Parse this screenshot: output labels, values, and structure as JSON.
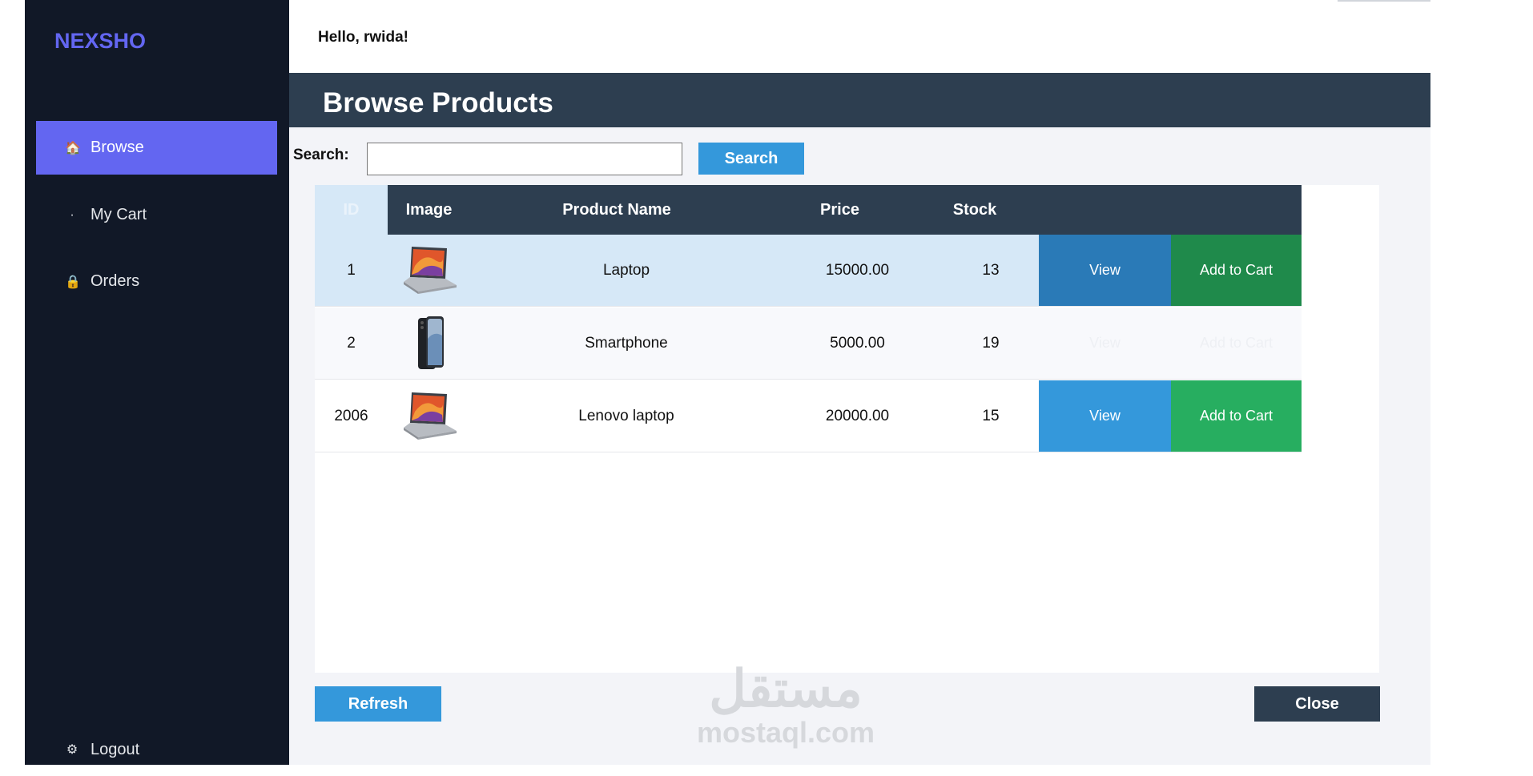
{
  "sidebar": {
    "brand": "NEXSHO",
    "items": [
      {
        "label": "Browse",
        "icon": "home-icon",
        "glyph": "🏠"
      },
      {
        "label": "My Cart",
        "icon": "bullet-icon",
        "glyph": "·"
      },
      {
        "label": "Orders",
        "icon": "lock-icon",
        "glyph": "🔒"
      }
    ],
    "logout": {
      "label": "Logout",
      "icon": "gear-icon",
      "glyph": "⚙"
    }
  },
  "header": {
    "greeting": "Hello, rwida!"
  },
  "page": {
    "title": "Browse Products"
  },
  "search": {
    "label": "Search:",
    "value": "",
    "button": "Search"
  },
  "table": {
    "columns": [
      "ID",
      "Image",
      "Product Name",
      "Price",
      "Stock"
    ],
    "rows": [
      {
        "id": "1",
        "image": "laptop-image",
        "name": "Laptop",
        "price": "15000.00",
        "stock": "13",
        "view": "View",
        "add": "Add to Cart"
      },
      {
        "id": "2",
        "image": "smartphone-image",
        "name": "Smartphone",
        "price": "5000.00",
        "stock": "19",
        "view": "View",
        "add": "Add to Cart"
      },
      {
        "id": "2006",
        "image": "laptop-image",
        "name": "Lenovo laptop",
        "price": "20000.00",
        "stock": "15",
        "view": "View",
        "add": "Add to Cart"
      }
    ]
  },
  "actions": {
    "refresh": "Refresh",
    "close": "Close"
  },
  "watermark": {
    "arabic": "مستقل",
    "latin": "mostaql.com"
  },
  "colors": {
    "sidebar_bg": "#111827",
    "accent": "#6366f1",
    "header_bg": "#2d3e50",
    "primary_blue": "#3498db",
    "success_green": "#27ae60"
  }
}
